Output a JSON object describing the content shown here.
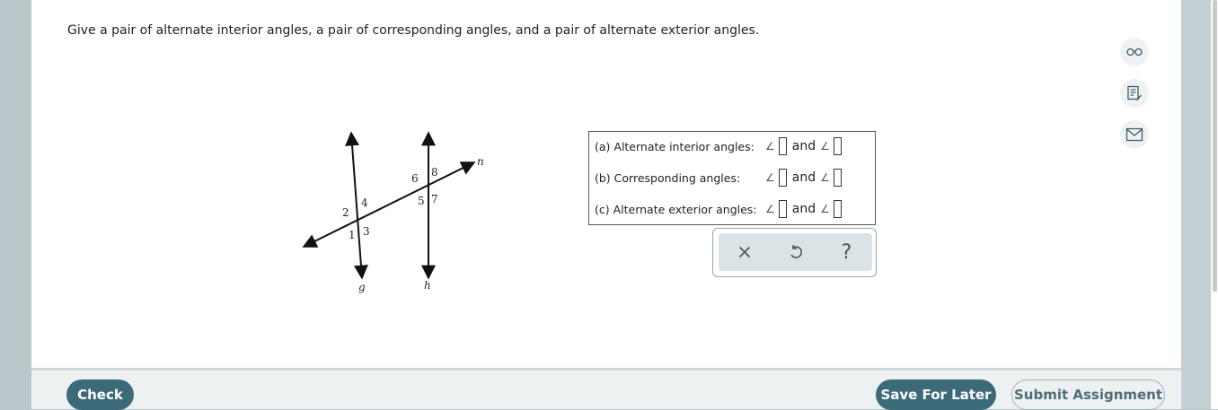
{
  "question": {
    "text": "Give a pair of alternate interior angles, a pair of corresponding angles, and a pair of alternate exterior angles."
  },
  "tools": [
    {
      "icon": "glasses-icon"
    },
    {
      "icon": "notes-icon"
    },
    {
      "icon": "mail-icon"
    }
  ],
  "figure": {
    "line_labels": [
      "g",
      "h",
      "n"
    ],
    "angle_labels": [
      "1",
      "2",
      "3",
      "4",
      "5",
      "6",
      "7",
      "8"
    ]
  },
  "answers": {
    "angle_symbol": "∠",
    "and_text": "and",
    "rows": [
      {
        "label": "(a) Alternate interior angles:",
        "first": "",
        "second": ""
      },
      {
        "label": "(b) Corresponding angles:",
        "first": "",
        "second": ""
      },
      {
        "label": "(c) Alternate exterior angles:",
        "first": "",
        "second": ""
      }
    ]
  },
  "keypad": {
    "clear_icon": "close-icon",
    "undo_icon": "undo-icon",
    "help_label": "?"
  },
  "footer": {
    "check_label": "Check",
    "save_label": "Save For Later",
    "submit_label": "Submit Assignment"
  }
}
